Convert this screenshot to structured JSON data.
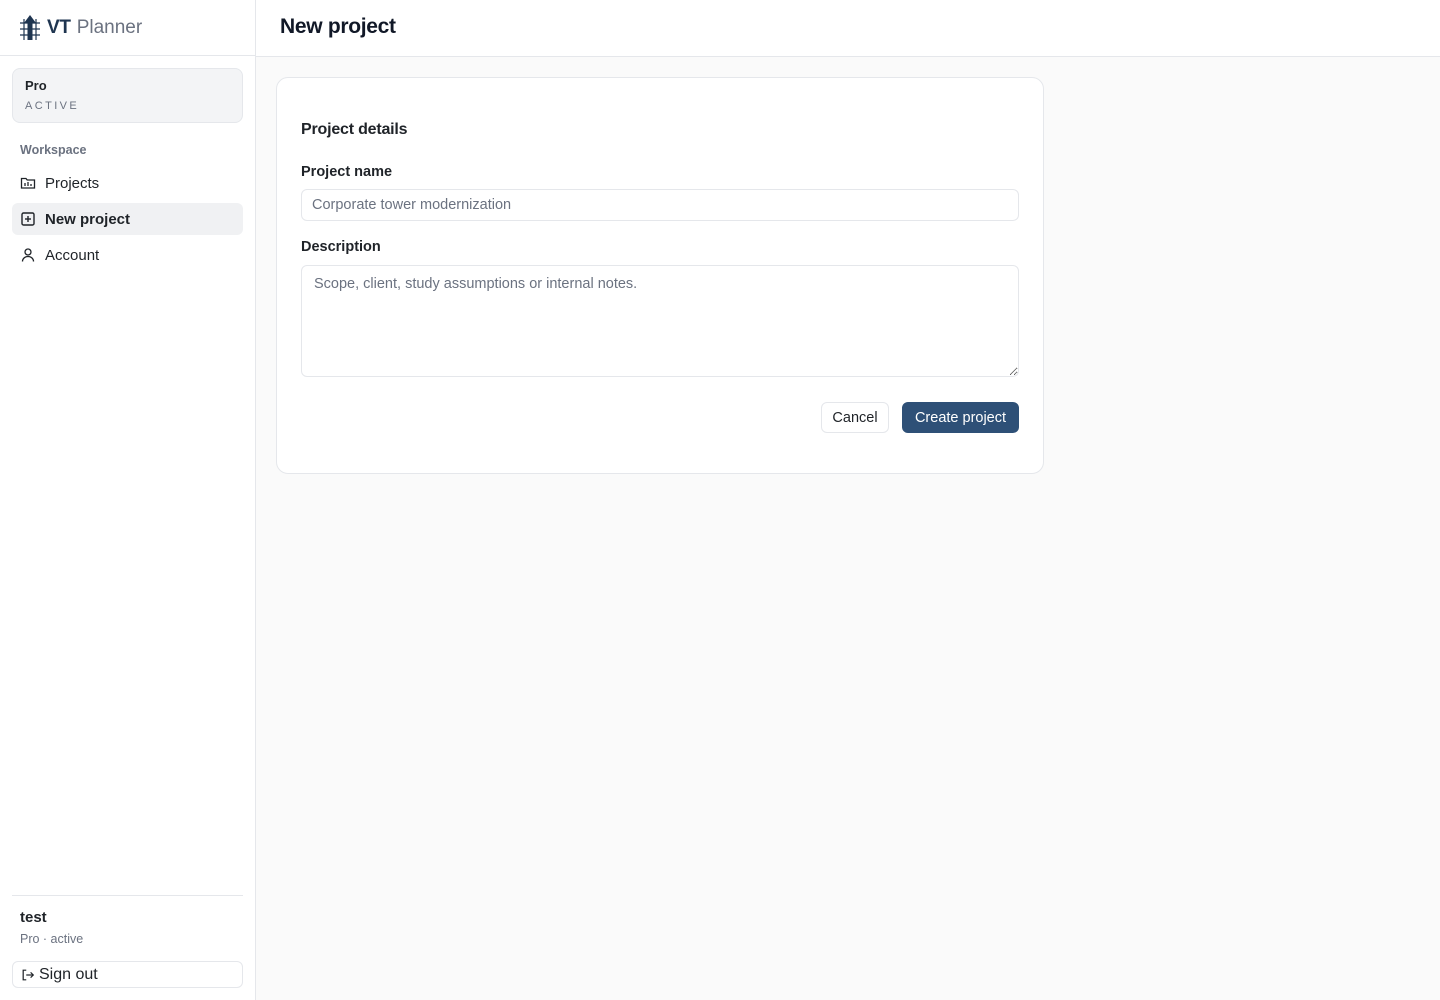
{
  "brand": {
    "bold": "VT",
    "light": "Planner"
  },
  "plan": {
    "name": "Pro",
    "status": "ACTIVE"
  },
  "nav": {
    "section": "Workspace",
    "items": [
      {
        "label": "Projects",
        "icon": "folder-icon"
      },
      {
        "label": "New project",
        "icon": "plus-square-icon",
        "active": true
      },
      {
        "label": "Account",
        "icon": "user-icon"
      }
    ]
  },
  "user": {
    "name": "test",
    "plan": "Pro · active"
  },
  "signout": {
    "label": "Sign out",
    "icon": "sign-out-icon"
  },
  "header": {
    "title": "New project"
  },
  "form": {
    "section_title": "Project details",
    "name_label": "Project name",
    "name_placeholder": "Corporate tower modernization",
    "name_value": "",
    "description_label": "Description",
    "description_placeholder": "Scope, client, study assumptions or internal notes.",
    "description_value": "",
    "cancel_label": "Cancel",
    "create_label": "Create project"
  },
  "colors": {
    "accent": "#2e5077",
    "brand_dark": "#1f3550",
    "muted": "#6b7280",
    "border": "#e5e7eb",
    "background": "#fafafa"
  }
}
